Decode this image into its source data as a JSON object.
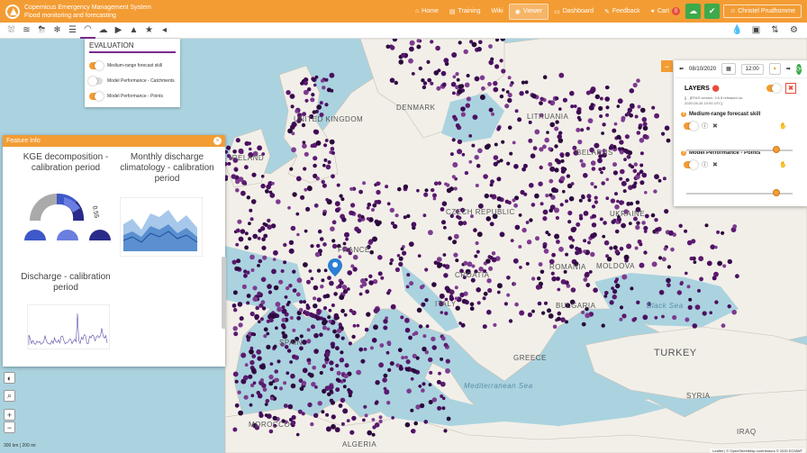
{
  "app": {
    "title_line1": "Copernicus Emergency Management System",
    "title_line2": "Flood monitoring and forecasting"
  },
  "nav": {
    "items": [
      {
        "label": "Home",
        "icon": "home-icon"
      },
      {
        "label": "Training",
        "icon": "training-icon"
      },
      {
        "label": "Wiki",
        "icon": ""
      },
      {
        "label": "Viewer",
        "icon": "viewer-icon"
      },
      {
        "label": "Dashboard",
        "icon": "dashboard-icon"
      },
      {
        "label": "Feedback",
        "icon": "feedback-icon"
      },
      {
        "label": "Cart",
        "icon": "cart-icon"
      }
    ],
    "cart_count": "0",
    "user": "Christel Prudhomme"
  },
  "evaluation": {
    "title": "EVALUATION",
    "items": [
      {
        "label": "Medium-range forecast skill",
        "on": true
      },
      {
        "label": "Model Performance - Catchments",
        "on": false
      },
      {
        "label": "Model Performance - Points",
        "on": true
      }
    ]
  },
  "feature_info": {
    "title": "Feature Info",
    "kge_title_1": "KGE decomposition -",
    "kge_title_2": "calibration period",
    "clim_title_1": "Monthly discharge",
    "clim_title_2": "climatology - calibration",
    "clim_title_3": "period",
    "discharge_title_1": "Discharge - calibration",
    "discharge_title_2": "period",
    "kge_value": "0.55"
  },
  "layers_panel": {
    "date": "08/10/2020",
    "time": "12:00",
    "title": "LAYERS",
    "subtitle_1": "[] - [EFAS version: 3.6.5 released on:",
    "subtitle_2": "2020-05-26 10:00 UTC]",
    "layer1": "Medium-range forecast skill",
    "layer2": "Model Performance - Points"
  },
  "map_labels": {
    "uk": "UNITED KINGDOM",
    "ireland": "IRELAND",
    "denmark": "DENMARK",
    "lithuania": "LITHUANIA",
    "belarus": "BELARUS",
    "ukraine": "UKRAINE",
    "france": "FRANCE",
    "czech": "CZECH REPUBLIC",
    "italy": "ITALY",
    "spain": "SPAIN",
    "romania": "ROMANIA",
    "bulgaria": "BULGARIA",
    "croatia": "CROATIA",
    "turkey": "TURKEY",
    "syria": "SYRIA",
    "iraq": "IRAQ",
    "morocco": "MOROCCO",
    "algeria": "ALGERIA",
    "greece": "GREECE",
    "black_sea": "Black Sea",
    "med_sea": "Mediterranean Sea",
    "moldova": "MOLDOVA"
  },
  "scale": {
    "km": "300 km",
    "mi": "200 mi"
  },
  "attribution": "Leaflet | © OpenStreetMap contributors © 2020 ECMWF"
}
